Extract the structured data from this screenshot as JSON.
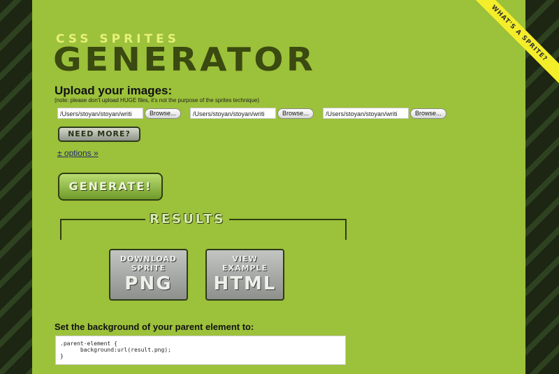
{
  "logo": {
    "top": "CSS SPRITES",
    "main": "GENERATOR"
  },
  "upload": {
    "title": "Upload your images:",
    "note": "(note: please don't upload HUGE files, it's not the purpose of the sprites technique)",
    "files": [
      {
        "value": "/Users/stoyan/stoyan/writi",
        "browse": "Browse..."
      },
      {
        "value": "/Users/stoyan/stoyan/writi",
        "browse": "Browse..."
      },
      {
        "value": "/Users/stoyan/stoyan/writi",
        "browse": "Browse..."
      }
    ],
    "need_more": "NEED MORE?",
    "options": "± options »"
  },
  "generate_label": "GENERATE!",
  "results": {
    "label": "RESULTS",
    "download": {
      "l1": "DOWNLOAD",
      "l2": "SPRITE",
      "l3": "PNG"
    },
    "view": {
      "l1": "VIEW",
      "l2": "EXAMPLE",
      "l3": "HTML"
    }
  },
  "background": {
    "title": "Set the background of your parent element to:",
    "code": ".parent-element {\n      background:url(result.png);\n}"
  },
  "ribbon": "WHAT'S A SPRITE?",
  "colors": {
    "main_bg": "#9cc13a",
    "side_bg": "#1e2a14",
    "ribbon": "#f4ee2a"
  }
}
